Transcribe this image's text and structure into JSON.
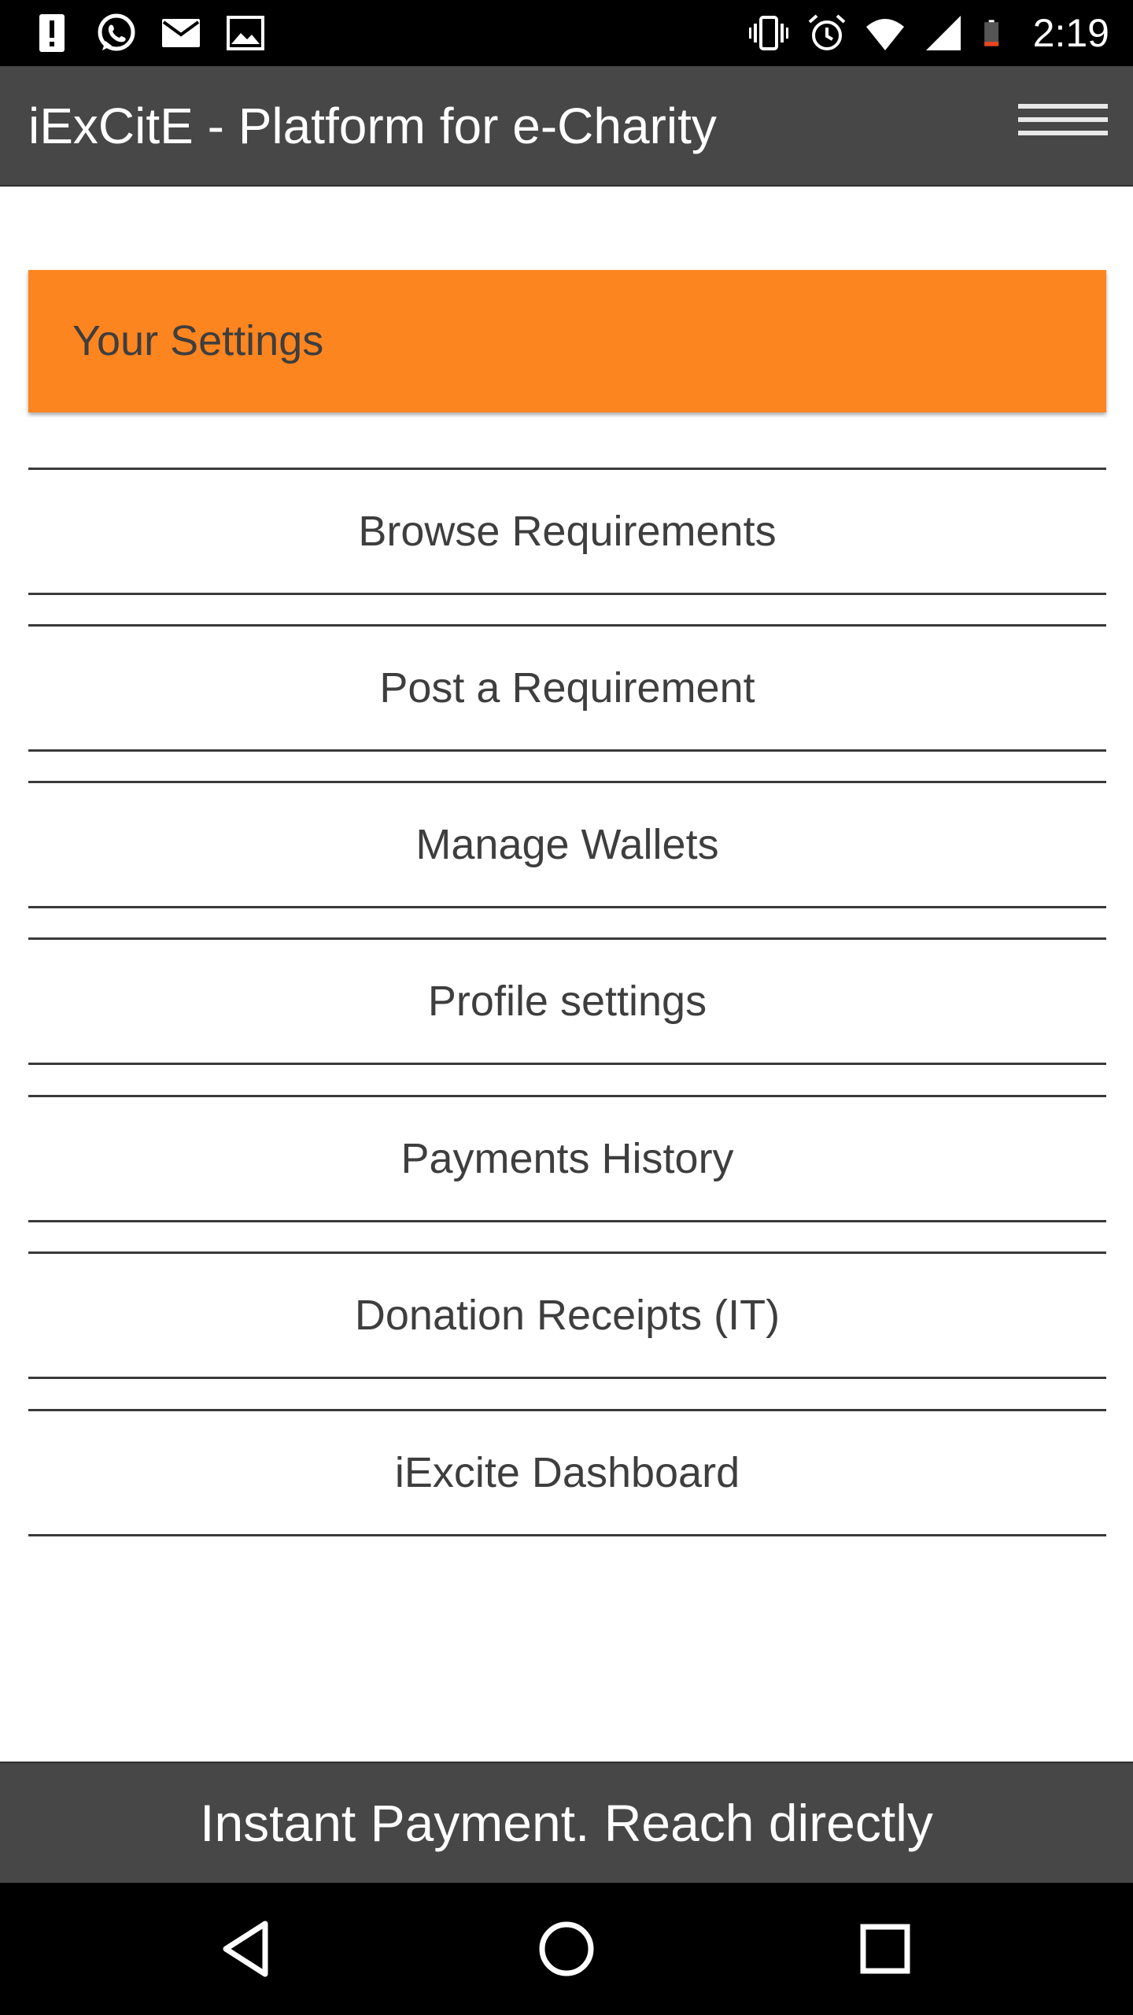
{
  "status_bar": {
    "left_icons": [
      "alert-icon",
      "whatsapp-icon",
      "email-icon",
      "image-icon"
    ],
    "right_icons": [
      "vibrate-icon",
      "alarm-icon",
      "wifi-icon",
      "signal-icon",
      "battery-icon"
    ],
    "time": "2:19",
    "battery_color": "#e8451e"
  },
  "app_bar": {
    "title": "iExCitE - Platform for e-Charity",
    "menu_icon": "hamburger-icon"
  },
  "settings": {
    "header": "Your Settings",
    "accent_color": "#fd851f"
  },
  "menu": {
    "items": [
      {
        "label": "Browse Requirements"
      },
      {
        "label": "Post a Requirement"
      },
      {
        "label": "Manage Wallets"
      },
      {
        "label": "Profile settings"
      },
      {
        "label": "Payments History"
      },
      {
        "label": "Donation Receipts (IT)"
      },
      {
        "label": "iExcite Dashboard"
      }
    ]
  },
  "footer": {
    "text": "Instant Payment. Reach directly"
  },
  "nav_bar": {
    "buttons": [
      "back-icon",
      "home-icon",
      "recents-icon"
    ]
  }
}
